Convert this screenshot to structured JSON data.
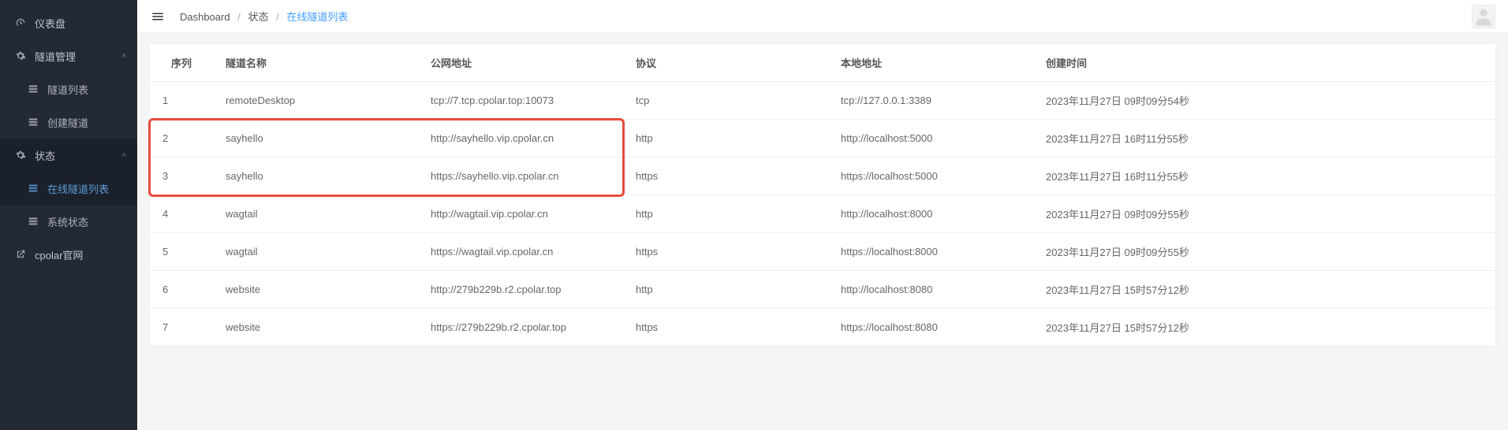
{
  "sidebar": {
    "dashboard": "仪表盘",
    "tunnel_mgmt": "隧道管理",
    "tunnel_list": "隧道列表",
    "tunnel_create": "创建隧道",
    "status": "状态",
    "online_list": "在线隧道列表",
    "system_status": "系统状态",
    "cpolar_site": "cpolar官网"
  },
  "breadcrumb": {
    "dashboard": "Dashboard",
    "status": "状态",
    "current": "在线隧道列表"
  },
  "table": {
    "headers": {
      "seq": "序列",
      "name": "隧道名称",
      "public_addr": "公网地址",
      "proto": "协议",
      "local_addr": "本地地址",
      "ctime": "创建时间"
    },
    "rows": [
      {
        "seq": "1",
        "name": "remoteDesktop",
        "public_addr": "tcp://7.tcp.cpolar.top:10073",
        "proto": "tcp",
        "local_addr": "tcp://127.0.0.1:3389",
        "ctime": "2023年11月27日 09时09分54秒"
      },
      {
        "seq": "2",
        "name": "sayhello",
        "public_addr": "http://sayhello.vip.cpolar.cn",
        "proto": "http",
        "local_addr": "http://localhost:5000",
        "ctime": "2023年11月27日 16时11分55秒"
      },
      {
        "seq": "3",
        "name": "sayhello",
        "public_addr": "https://sayhello.vip.cpolar.cn",
        "proto": "https",
        "local_addr": "https://localhost:5000",
        "ctime": "2023年11月27日 16时11分55秒"
      },
      {
        "seq": "4",
        "name": "wagtail",
        "public_addr": "http://wagtail.vip.cpolar.cn",
        "proto": "http",
        "local_addr": "http://localhost:8000",
        "ctime": "2023年11月27日 09时09分55秒"
      },
      {
        "seq": "5",
        "name": "wagtail",
        "public_addr": "https://wagtail.vip.cpolar.cn",
        "proto": "https",
        "local_addr": "https://localhost:8000",
        "ctime": "2023年11月27日 09时09分55秒"
      },
      {
        "seq": "6",
        "name": "website",
        "public_addr": "http://279b229b.r2.cpolar.top",
        "proto": "http",
        "local_addr": "http://localhost:8080",
        "ctime": "2023年11月27日 15时57分12秒"
      },
      {
        "seq": "7",
        "name": "website",
        "public_addr": "https://279b229b.r2.cpolar.top",
        "proto": "https",
        "local_addr": "https://localhost:8080",
        "ctime": "2023年11月27日 15时57分12秒"
      }
    ]
  }
}
